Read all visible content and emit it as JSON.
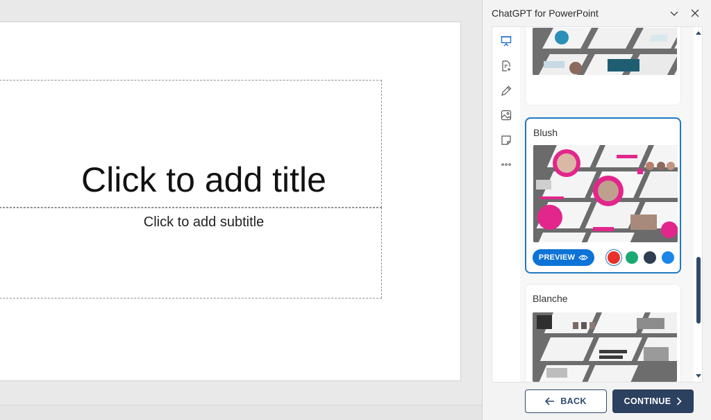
{
  "slide": {
    "title_placeholder": "Click to add title",
    "subtitle_placeholder": "Click to add subtitle"
  },
  "pane": {
    "title": "ChatGPT for PowerPoint",
    "header_icons": [
      "chevron-down-icon",
      "close-icon"
    ],
    "tools": [
      "presentation-icon",
      "document-add-icon",
      "pencil-icon",
      "image-icon",
      "sticky-note-icon",
      "more-icon"
    ]
  },
  "templates": [
    {
      "name": "",
      "selected": false
    },
    {
      "name": "Blush",
      "selected": true,
      "preview_label": "PREVIEW",
      "swatches": [
        "#e8312a",
        "#1aa873",
        "#2f3e52",
        "#1a86e8"
      ],
      "active_swatch": 0
    },
    {
      "name": "Blanche",
      "selected": false
    }
  ],
  "footer": {
    "back_label": "BACK",
    "continue_label": "CONTINUE"
  },
  "colors": {
    "accent_blue": "#0d73d6",
    "selected_border": "#1f79c2",
    "primary_dark": "#2c4160"
  }
}
